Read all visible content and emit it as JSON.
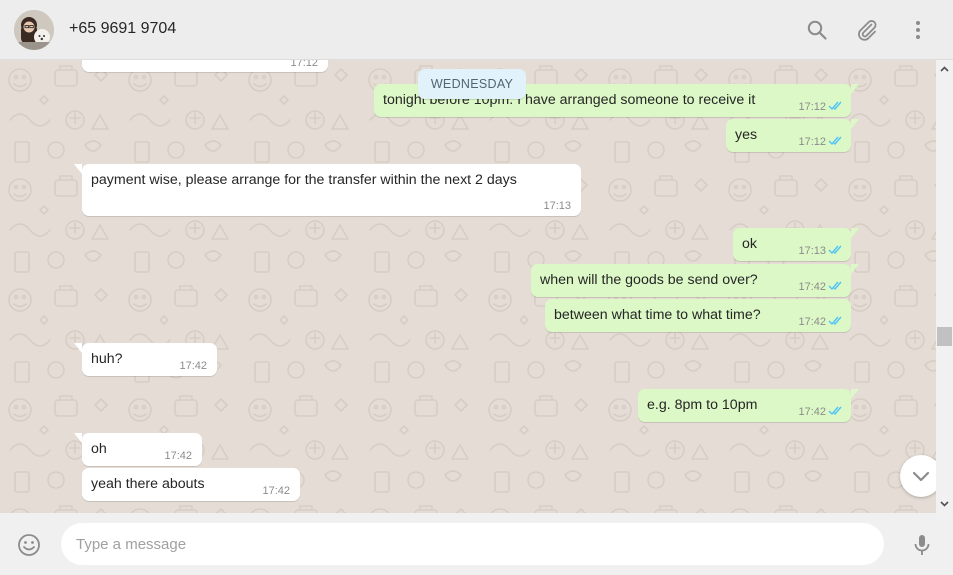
{
  "header": {
    "contact_name": "+65 9691 9704",
    "icons": [
      "search-icon",
      "attach-icon",
      "menu-icon"
    ]
  },
  "conversation": {
    "top_partial_message": {
      "text": "",
      "time": "17:12",
      "direction": "in"
    },
    "day_label": "WEDNESDAY",
    "messages": [
      {
        "direction": "out",
        "text": "tonight before 10pm. I have arranged someone to receive it",
        "time": "17:12",
        "status": "read"
      },
      {
        "direction": "out",
        "text": "yes",
        "time": "17:12",
        "status": "read"
      },
      {
        "direction": "in",
        "text": "payment wise, please arrange for the transfer within the next 2 days",
        "time": "17:13"
      },
      {
        "direction": "out",
        "text": "ok",
        "time": "17:13",
        "status": "read"
      },
      {
        "direction": "out",
        "text": "when will the goods be send over?",
        "time": "17:42",
        "status": "read"
      },
      {
        "direction": "out",
        "text": "between what time to what time?",
        "time": "17:42",
        "status": "read"
      },
      {
        "direction": "in",
        "text": "huh?",
        "time": "17:42"
      },
      {
        "direction": "out",
        "text": "e.g. 8pm to 10pm",
        "time": "17:42",
        "status": "read"
      },
      {
        "direction": "in",
        "text": "oh",
        "time": "17:42"
      },
      {
        "direction": "in",
        "text": "yeah there abouts",
        "time": "17:42"
      }
    ]
  },
  "composer": {
    "value": "",
    "placeholder": "Type a message",
    "icons": [
      "emoji-icon",
      "microphone-icon"
    ]
  },
  "colors": {
    "header_bg": "#ededed",
    "chat_bg": "#e5ddd5",
    "incoming_bubble": "#ffffff",
    "outgoing_bubble": "#dcf8c6",
    "read_ticks": "#4fc3f7",
    "day_chip": "#e1f2fb"
  }
}
